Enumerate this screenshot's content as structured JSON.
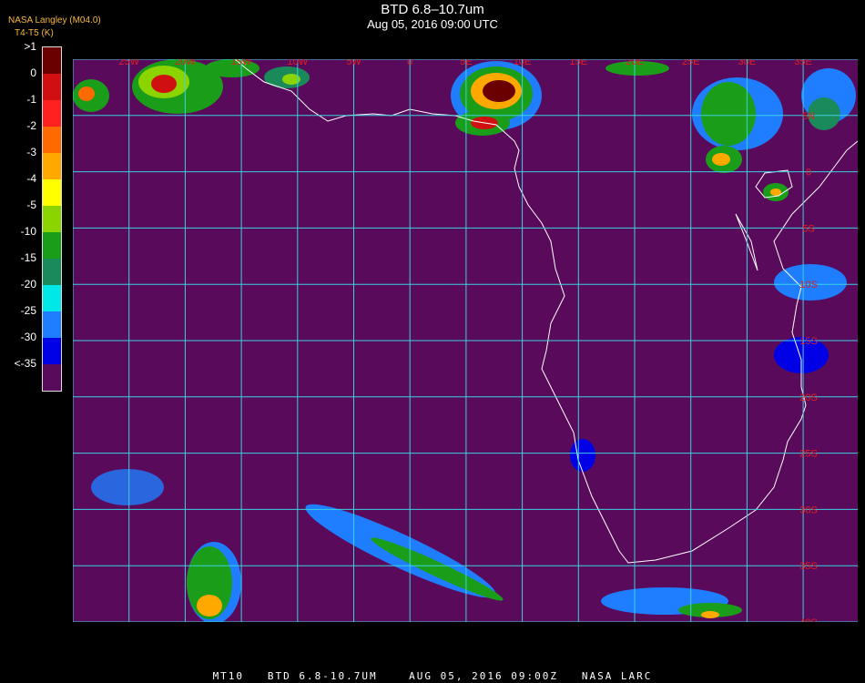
{
  "header": {
    "title": "BTD 6.8–10.7um",
    "subtitle": "Aug 05, 2016 09:00 UTC",
    "organization": "NASA Langley (M04.0)",
    "parameter": "T4-T5 (K)"
  },
  "legend": {
    "labels": [
      ">1",
      "0",
      "-1",
      "-2",
      "-3",
      "-4",
      "-5",
      "-10",
      "-15",
      "-20",
      "-25",
      "-30",
      "<-35"
    ],
    "colors": [
      "#6b0000",
      "#d01010",
      "#ff2020",
      "#ff6a00",
      "#ffa800",
      "#ffff00",
      "#8cd400",
      "#1a9e1a",
      "#1a8a5a",
      "#00e8e8",
      "#1e7eff",
      "#0000e6",
      "#5a0a5a"
    ]
  },
  "map": {
    "background_color": "#5a0a5a",
    "grid_color": "#3ad0e0",
    "coastline_color": "#ffffff",
    "lon_labels": [
      "25W",
      "20W",
      "15W",
      "10W",
      "5W",
      "0",
      "5E",
      "10E",
      "15E",
      "20E",
      "25E",
      "30E",
      "35E"
    ],
    "lat_labels": [
      "5N",
      "0",
      "5S",
      "10S",
      "15S",
      "20S",
      "25S",
      "30S",
      "35S",
      "40S"
    ]
  },
  "footer": {
    "text": "MT10   BTD 6.8-10.7UM    AUG 05, 2016 09:00Z   NASA LARC"
  }
}
